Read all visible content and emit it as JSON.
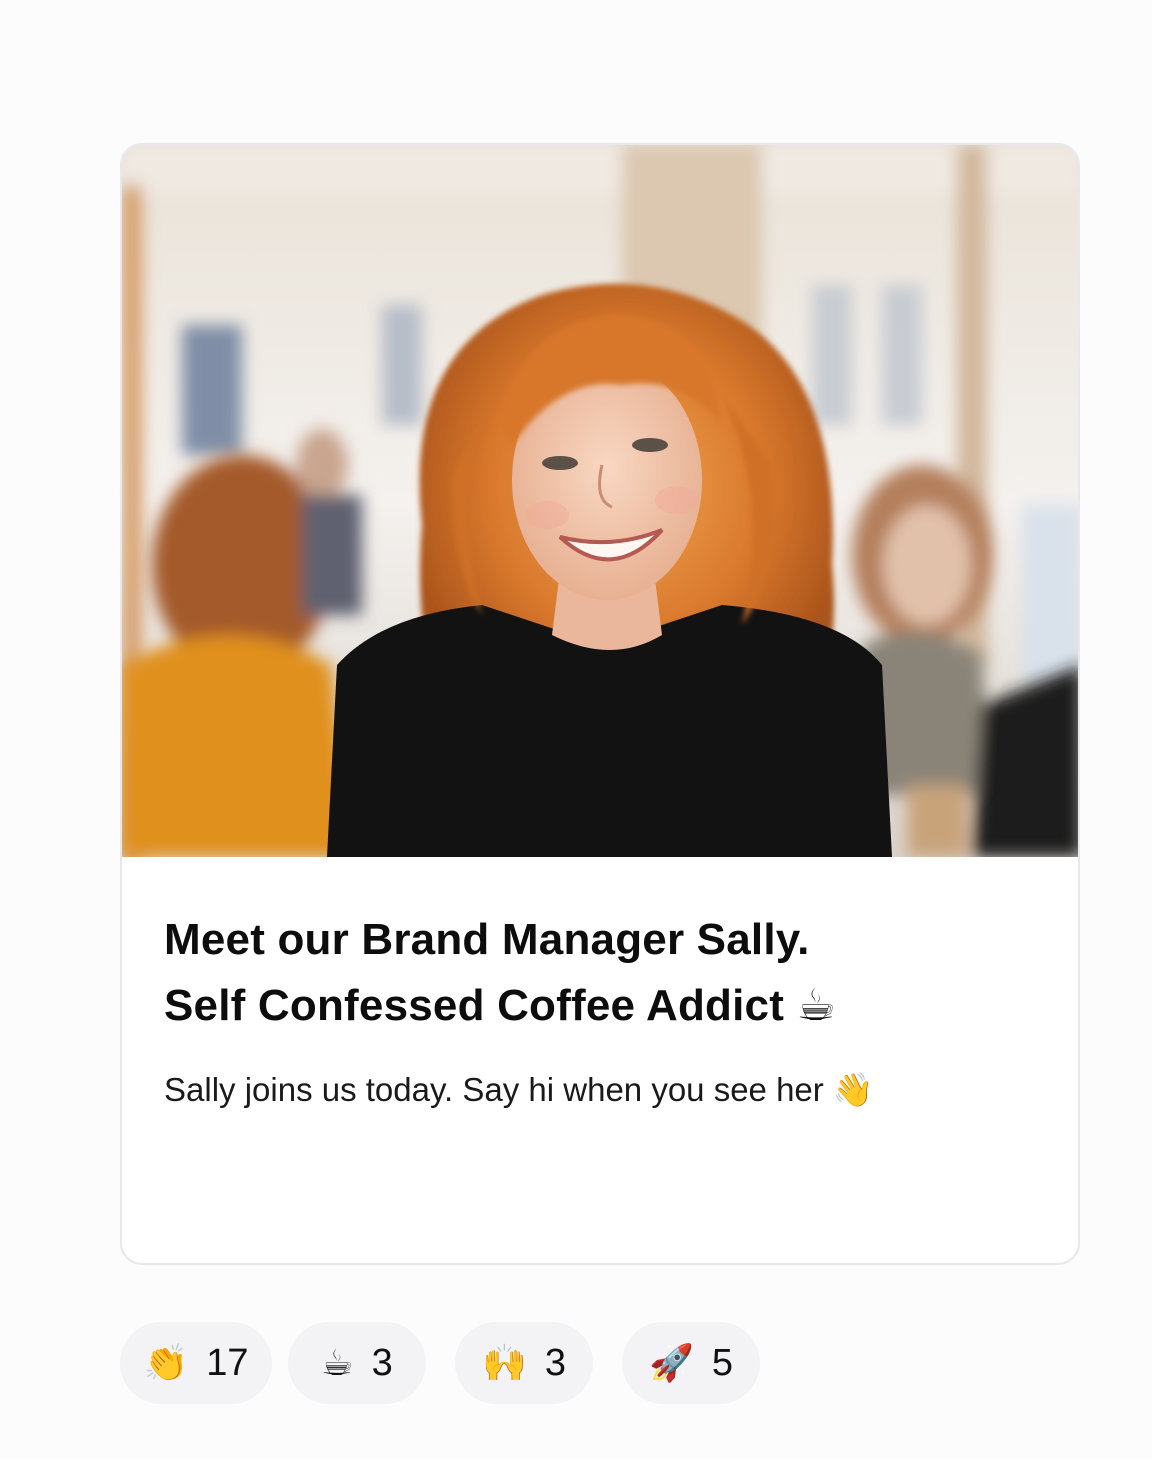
{
  "post": {
    "image_alt": "Smiling woman with curly red hair in a sunlit cafe",
    "title_line1": "Meet our Brand Manager Sally.",
    "title_line2": "Self Confessed Coffee Addict ☕",
    "description": "Sally joins us today. Say hi when you see her 👋"
  },
  "reactions": [
    {
      "emoji": "👏",
      "icon": "clapping-hands-icon",
      "count": "17"
    },
    {
      "emoji": "☕",
      "icon": "coffee-icon",
      "count": "3"
    },
    {
      "emoji": "🙌",
      "icon": "raising-hands-icon",
      "count": "3"
    },
    {
      "emoji": "🚀",
      "icon": "rocket-icon",
      "count": "5"
    }
  ],
  "colors": {
    "card_border": "#e7e7ec",
    "reaction_bg": "#f3f3f6",
    "text": "#111111"
  }
}
